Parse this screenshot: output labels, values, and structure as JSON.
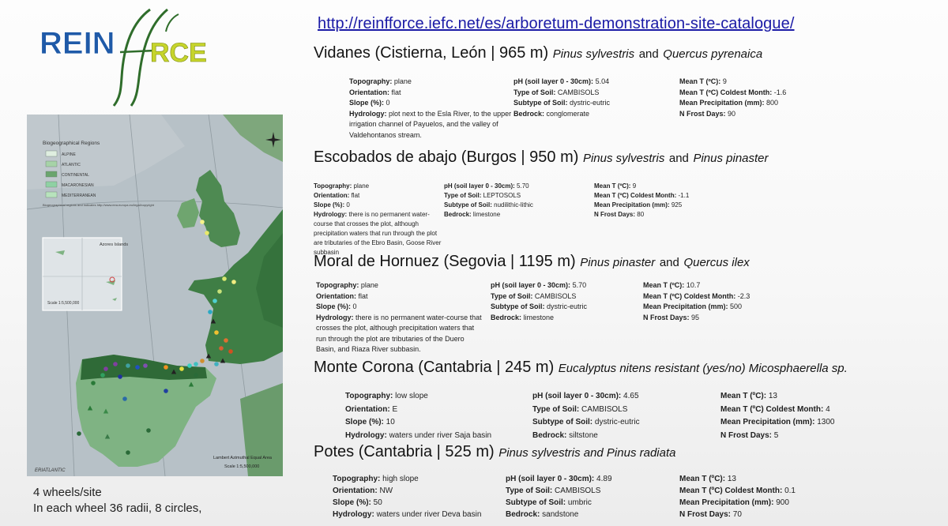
{
  "logo": {
    "text": "REINFORCE"
  },
  "url": "http://reinfforce.iefc.net/es/arboretum-demonstration-site-catalogue/",
  "map": {
    "legend_title": "Biogeographical Regions",
    "legend_items": [
      {
        "label": "ALPINE",
        "color": "#dfeee0"
      },
      {
        "label": "ATLANTIC",
        "color": "#a6d3a7"
      },
      {
        "label": "CONTINENTAL",
        "color": "#6aa56d"
      },
      {
        "label": "MACARONESIAN",
        "color": "#8fd1a3"
      },
      {
        "label": "MEDITERRANEAN",
        "color": "#b7e3bc"
      }
    ],
    "legend_note": "Biogeographical regions and indicates\nhttp://www.eea.europa.eu/legal/copyright",
    "inset_label": "Azores Islands",
    "inset_scale": "Scale 1:5,500,000",
    "projection": "Lambert Azimuthal Equal Area",
    "scale": "Scale 1:5,500,000",
    "credit": "ERIATLANTIC"
  },
  "sites": [
    {
      "name": "Vidanes (Cistierna, León | 965 m)",
      "species1": "Pinus sylvestris",
      "conj": "and",
      "species2": "Quercus pyrenaica",
      "col1": [
        {
          "k": "Topography:",
          "v": "plane"
        },
        {
          "k": "Orientation:",
          "v": "flat"
        },
        {
          "k": "Slope (%):",
          "v": "0"
        },
        {
          "k": "Hydrology:",
          "v": "plot next to the Esla River, to the upper irrigation channel of Payuelos, and the valley of Valdehontanos stream."
        }
      ],
      "col2": [
        {
          "k": "pH (soil layer 0 - 30cm):",
          "v": "5.04"
        },
        {
          "k": "Type of Soil:",
          "v": "CAMBISOLS"
        },
        {
          "k": "Subtype of Soil:",
          "v": "dystric-eutric"
        },
        {
          "k": "Bedrock:",
          "v": "conglomerate"
        }
      ],
      "col3": [
        {
          "k": "Mean T (ºC):",
          "v": "9"
        },
        {
          "k": "Mean T (ºC) Coldest Month:",
          "v": "-1.6"
        },
        {
          "k": "Mean Precipitation (mm):",
          "v": "800"
        },
        {
          "k": "N Frost Days:",
          "v": "90"
        }
      ]
    },
    {
      "name": "Escobados de abajo (Burgos | 950 m)",
      "species1": "Pinus sylvestris",
      "conj": "and",
      "species2": "Pinus pinaster",
      "col1": [
        {
          "k": "Topography:",
          "v": "plane"
        },
        {
          "k": "Orientation:",
          "v": "flat"
        },
        {
          "k": "Slope (%):",
          "v": "0"
        },
        {
          "k": "Hydrology:",
          "v": "there is no permanent water-course that crosses the plot, although precipitation waters that run through the plot are tributaries of the Ebro Basin, Goose River subbasin"
        }
      ],
      "col2": [
        {
          "k": "pH (soil layer 0 - 30cm):",
          "v": "5.70"
        },
        {
          "k": "Type of Soil:",
          "v": "LEPTOSOLS"
        },
        {
          "k": "Subtype of Soil:",
          "v": "nudilithic-lithic"
        },
        {
          "k": "Bedrock:",
          "v": "limestone"
        }
      ],
      "col3": [
        {
          "k": "Mean T (ºC):",
          "v": "9"
        },
        {
          "k": "Mean T (ºC) Coldest Month:",
          "v": "-1.1"
        },
        {
          "k": "Mean Precipitation (mm):",
          "v": "925"
        },
        {
          "k": "N Frost Days:",
          "v": "80"
        }
      ]
    },
    {
      "name": "Moral de Hornuez (Segovia | 1195 m)",
      "species1": "Pinus pinaster",
      "conj": "and",
      "species2": "Quercus ilex",
      "col1": [
        {
          "k": "Topography:",
          "v": "plane"
        },
        {
          "k": "Orientation:",
          "v": "flat"
        },
        {
          "k": "Slope (%):",
          "v": "0"
        },
        {
          "k": "Hydrology:",
          "v": "there is no permanent water-course that crosses the plot, although precipitation waters that run through the plot are tributaries of the Duero Basin, and Riaza River subbasin."
        }
      ],
      "col2": [
        {
          "k": "pH (soil layer 0 - 30cm):",
          "v": "5.70"
        },
        {
          "k": "Type of Soil:",
          "v": "CAMBISOLS"
        },
        {
          "k": "Subtype of Soil:",
          "v": "dystric-eutric"
        },
        {
          "k": "Bedrock:",
          "v": "limestone"
        }
      ],
      "col3": [
        {
          "k": "Mean T (ºC):",
          "v": "10.7"
        },
        {
          "k": "Mean T (ºC) Coldest Month:",
          "v": "-2.3"
        },
        {
          "k": "Mean Precipitation (mm):",
          "v": "500"
        },
        {
          "k": "N Frost Days:",
          "v": "95"
        }
      ]
    },
    {
      "name": "Monte Corona (Cantabria | 245 m)",
      "species1": "Eucalyptus nitens resistant (yes/no) Micosphaerella sp.",
      "conj": "",
      "species2": "",
      "col1": [
        {
          "k": "Topography:",
          "v": "low slope"
        },
        {
          "k": "Orientation:",
          "v": "E"
        },
        {
          "k": "Slope (%):",
          "v": "10"
        },
        {
          "k": "Hydrology:",
          "v": "waters under river Saja basin"
        }
      ],
      "col2": [
        {
          "k": "pH (soil layer 0 - 30cm):",
          "v": "4.65"
        },
        {
          "k": "Type of Soil:",
          "v": "CAMBISOLS"
        },
        {
          "k": "Subtype of Soil:",
          "v": "dystric-eutric"
        },
        {
          "k": "Bedrock:",
          "v": "siltstone"
        }
      ],
      "col3": [
        {
          "k": "Mean T (ºC):",
          "v": "13"
        },
        {
          "k": "Mean T (ºC) Coldest Month:",
          "v": "4"
        },
        {
          "k": "Mean Precipitation (mm):",
          "v": "1300"
        },
        {
          "k": "N Frost Days:",
          "v": "5"
        }
      ]
    },
    {
      "name": "Potes (Cantabria | 525 m)",
      "species1": "Pinus sylvestris and Pinus radiata",
      "conj": "",
      "species2": "",
      "col1": [
        {
          "k": "Topography:",
          "v": "high slope"
        },
        {
          "k": "Orientation:",
          "v": "NW"
        },
        {
          "k": "Slope (%):",
          "v": "50"
        },
        {
          "k": "Hydrology:",
          "v": "waters under river Deva basin"
        }
      ],
      "col2": [
        {
          "k": "pH (soil layer 0 - 30cm):",
          "v": "4.89"
        },
        {
          "k": "Type of Soil:",
          "v": "CAMBISOLS"
        },
        {
          "k": "Subtype of Soil:",
          "v": "umbric"
        },
        {
          "k": "Bedrock:",
          "v": "sandstone"
        }
      ],
      "col3": [
        {
          "k": "Mean T (ºC):",
          "v": "13"
        },
        {
          "k": "Mean T (ºC) Coldest Month:",
          "v": "0.1"
        },
        {
          "k": "Mean Precipitation (mm):",
          "v": "900"
        },
        {
          "k": "N Frost Days:",
          "v": "70"
        }
      ]
    }
  ],
  "notes": {
    "line1": "4 wheels/site",
    "line2": "In each wheel 36 radii, 8 circles,"
  }
}
